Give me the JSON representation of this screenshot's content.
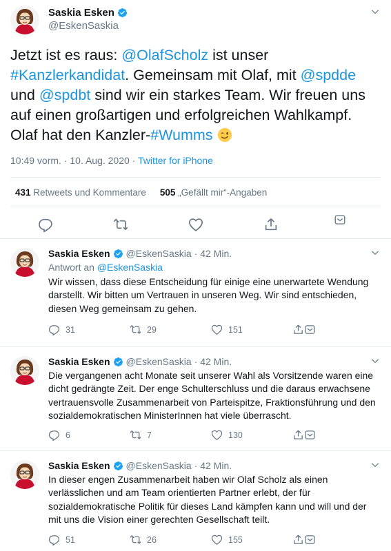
{
  "main_tweet": {
    "author_name": "Saskia Esken",
    "author_handle": "@EskenSaskia",
    "text_parts": {
      "p1": "Jetzt ist es raus: ",
      "m1": "@OlafScholz",
      "p2": " ist unser ",
      "h1": "#Kanzlerkandidat",
      "p3": ". Gemeinsam mit Olaf, mit ",
      "m2": "@spdde",
      "p4": " und ",
      "m3": "@spdbt",
      "p5": " sind wir ein starkes Team. Wir freuen uns auf einen großartigen und erfolgreichen Wahlkampf. Olaf hat den Kanzler-",
      "h2": "#Wumms"
    },
    "emoji": "winking-face",
    "timestamp": "10:49 vorm. · 10. Aug. 2020 · ",
    "source": "Twitter for iPhone",
    "retweets_count": "431",
    "retweets_label": "Retweets und Kommentare",
    "likes_count": "505",
    "likes_label": "„Gefällt mir“-Angaben"
  },
  "replies": [
    {
      "name": "Saskia Esken",
      "handle": "@EskenSaskia",
      "time": "· 42 Min.",
      "reply_to_prefix": "Antwort an ",
      "reply_to_handle": "@EskenSaskia",
      "text": "Wir wissen, dass diese Entscheidung für einige eine unerwartete Wendung darstellt. Wir bitten um Vertrauen in unseren Weg. Wir sind entschieden, diesen Weg gemeinsam zu gehen.",
      "replies": "31",
      "retweets": "29",
      "likes": "151"
    },
    {
      "name": "Saskia Esken",
      "handle": "@EskenSaskia",
      "time": "· 42 Min.",
      "text": "Die vergangenen acht Monate seit unserer Wahl als Vorsitzende waren eine dicht gedrängte Zeit. Der enge Schulterschluss und die daraus erwachsene vertrauensvolle Zusammenarbeit von Parteispitze, Fraktionsführung und den sozialdemokratischen MinisterInnen hat viele überrascht.",
      "replies": "6",
      "retweets": "7",
      "likes": "130"
    },
    {
      "name": "Saskia Esken",
      "handle": "@EskenSaskia",
      "time": "· 42 Min.",
      "text": "In dieser engen Zusammenarbeit haben wir Olaf Scholz als einen verlässlichen und am Team orientierten Partner erlebt, der für sozialdemokratische Politik für dieses Land kämpfen kann und will und der mit uns die Vision einer gerechten Gesellschaft teilt.",
      "replies": "51",
      "retweets": "26",
      "likes": "155"
    }
  ],
  "colors": {
    "link": "#1b95e0",
    "muted": "#657786",
    "text": "#14171a",
    "divider": "#e6ecf0",
    "verified": "#1da1f2"
  }
}
